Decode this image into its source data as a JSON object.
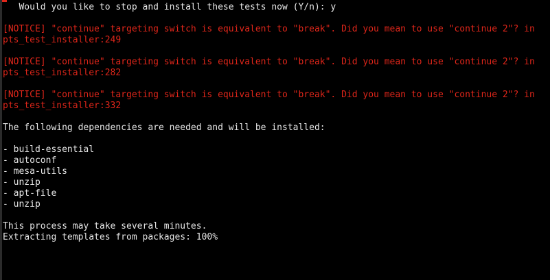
{
  "prompt": {
    "text": "   Would you like to stop and install these tests now (Y/n): y"
  },
  "notices": [
    {
      "line1": "[NOTICE] \"continue\" targeting switch is equivalent to \"break\". Did you mean to use \"continue 2\"? in",
      "line2": "pts_test_installer:249"
    },
    {
      "line1": "[NOTICE] \"continue\" targeting switch is equivalent to \"break\". Did you mean to use \"continue 2\"? in",
      "line2": "pts_test_installer:282"
    },
    {
      "line1": "[NOTICE] \"continue\" targeting switch is equivalent to \"break\". Did you mean to use \"continue 2\"? in",
      "line2": "pts_test_installer:332"
    }
  ],
  "dependencies": {
    "header": "The following dependencies are needed and will be installed:",
    "items": [
      "- build-essential",
      "- autoconf",
      "- mesa-utils",
      "- unzip",
      "- apt-file",
      "- unzip"
    ]
  },
  "status": {
    "process_note": "This process may take several minutes.",
    "extracting": "Extracting templates from packages: 100%"
  },
  "colors": {
    "background": "#000000",
    "text": "#e6e6e6",
    "notice": "#e0261a"
  }
}
